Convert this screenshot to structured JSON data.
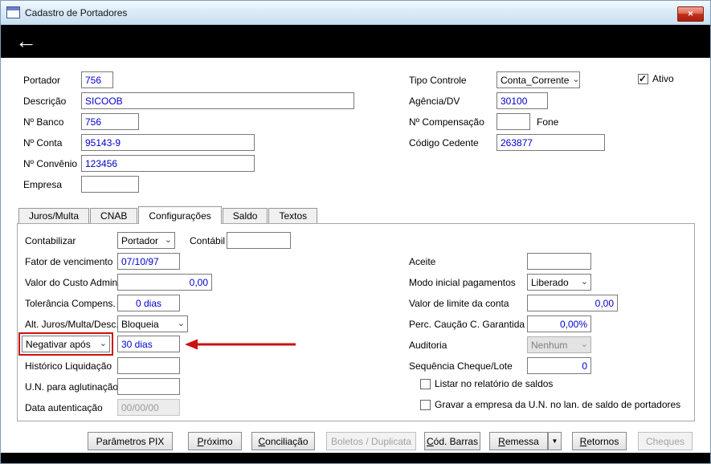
{
  "window": {
    "title": "Cadastro de Portadores"
  },
  "icons": {
    "close": "✕",
    "back": "←",
    "chevron_down": "⌄",
    "menu_down": "▼"
  },
  "colors": {
    "value_text": "#0000cc",
    "annotation": "#cc1010",
    "header_bar": "#000000"
  },
  "form_top": {
    "portador": {
      "label": "Portador",
      "value": "756"
    },
    "descricao": {
      "label": "Descrição",
      "value": "SICOOB"
    },
    "n_banco": {
      "label": "Nº Banco",
      "value": "756"
    },
    "n_conta": {
      "label": "Nº Conta",
      "value": "95143-9"
    },
    "n_convenio": {
      "label": "Nº Convênio",
      "value": "123456"
    },
    "empresa": {
      "label": "Empresa",
      "value": ""
    },
    "tipo_controle": {
      "label": "Tipo Controle",
      "value": "Conta_Corrente"
    },
    "agencia_dv": {
      "label": "Agência/DV",
      "value": "30100"
    },
    "n_compensacao": {
      "label": "Nº Compensação",
      "value": ""
    },
    "fone": {
      "label": "Fone"
    },
    "codigo_cedente": {
      "label": "Código Cedente",
      "value": "263877"
    },
    "ativo": {
      "label": "Ativo",
      "checked": true
    }
  },
  "tabs": [
    {
      "label": "Juros/Multa",
      "active": false
    },
    {
      "label": "CNAB",
      "active": false
    },
    {
      "label": "Configurações",
      "active": true
    },
    {
      "label": "Saldo",
      "active": false
    },
    {
      "label": "Textos",
      "active": false
    }
  ],
  "config": {
    "contabilizar": {
      "label": "Contabilizar",
      "value": "Portador"
    },
    "contabil": {
      "label": "Contábil",
      "value": ""
    },
    "fator_vencimento": {
      "label": "Fator de vencimento",
      "value": "07/10/97"
    },
    "custo_admin": {
      "label": "Valor do Custo Admin.",
      "value": "0,00"
    },
    "tolerancia": {
      "label": "Tolerância Compens.",
      "value": "0 dias"
    },
    "alt_juros": {
      "label": "Alt. Juros/Multa/Desc.",
      "value": "Bloqueia"
    },
    "negativar": {
      "label": "Negativar após",
      "value": "30 dias"
    },
    "historico": {
      "label": "Histórico Liquidação",
      "value": ""
    },
    "un_aglutinacao": {
      "label": "U.N. para aglutinação",
      "value": ""
    },
    "data_autenticacao": {
      "label": "Data autenticação",
      "value": "00/00/00"
    },
    "aceite": {
      "label": "Aceite",
      "value": ""
    },
    "modo_pagamentos": {
      "label": "Modo inicial pagamentos",
      "value": "Liberado"
    },
    "limite_conta": {
      "label": "Valor de limite da conta",
      "value": "0,00"
    },
    "perc_caucao": {
      "label": "Perc. Caução C. Garantida",
      "value": "0,00%"
    },
    "auditoria": {
      "label": "Auditoria",
      "value": "Nenhum"
    },
    "seq_cheque_lote": {
      "label": "Sequência Cheque/Lote",
      "value": "0"
    },
    "listar_saldos": {
      "label": "Listar no relatório de saldos",
      "checked": false
    },
    "gravar_empresa": {
      "label": "Gravar a empresa da U.N. no lan. de saldo de portadores",
      "checked": false
    }
  },
  "buttons": {
    "parametros_pix": "Parâmetros PIX",
    "proximo": "Próximo",
    "conciliacao": "Conciliação",
    "boletos_duplicata": "Boletos / Duplicata",
    "cod_barras": "Cód. Barras",
    "remessa": "Remessa",
    "retornos": "Retornos",
    "cheques": "Cheques"
  }
}
